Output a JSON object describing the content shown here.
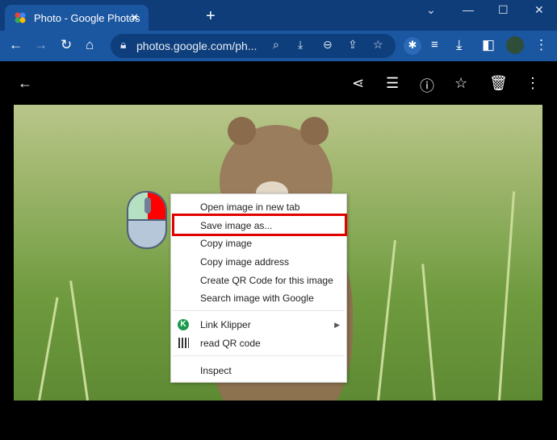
{
  "browser": {
    "tab_title": "Photo - Google Photos",
    "url": "photos.google.com/ph..."
  },
  "context_menu": {
    "items": [
      {
        "label": "Open image in new tab"
      },
      {
        "label": "Save image as..."
      },
      {
        "label": "Copy image"
      },
      {
        "label": "Copy image address"
      },
      {
        "label": "Create QR Code for this image"
      },
      {
        "label": "Search image with Google"
      },
      {
        "label": "Link Klipper"
      },
      {
        "label": "read QR code"
      },
      {
        "label": "Inspect"
      }
    ],
    "highlighted": "Save image as...",
    "highlight_color": "#e00000"
  }
}
